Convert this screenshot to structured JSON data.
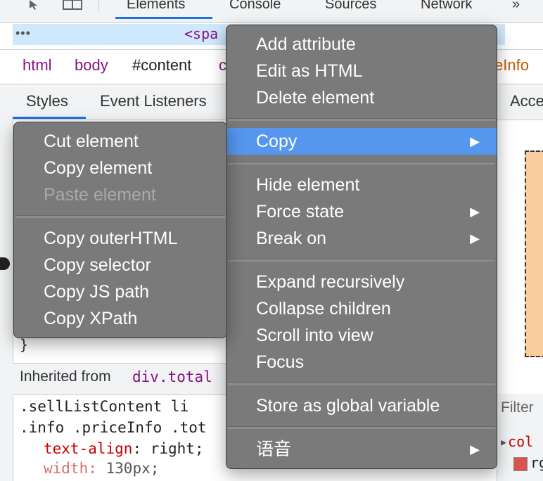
{
  "toolbar": {
    "tabs": [
      "Elements",
      "Console",
      "Sources",
      "Network"
    ],
    "more": "»"
  },
  "dom": {
    "ellipsis": "•••",
    "code": "<spa"
  },
  "breadcrumbs": [
    "html",
    "body",
    "#content",
    "c",
    "eInfo"
  ],
  "subtabs": [
    "Styles",
    "Event Listeners",
    "Acce"
  ],
  "styles_pane": {
    "brace": "}",
    "inherited_label": "Inherited from",
    "inherited_selector": "div.total",
    "rule_line1": ".sellListContent li",
    "rule_line2": ".info .priceInfo .tot",
    "prop1_name": "text-align",
    "prop1_value": "right;",
    "prop2_name": "width",
    "prop2_value": "130px;"
  },
  "right_pane": {
    "filter": "Filter",
    "computed_prop": "col",
    "computed_value": "rg"
  },
  "main_menu": {
    "items": [
      "Add attribute",
      "Edit as HTML",
      "Delete element",
      "Copy",
      "Hide element",
      "Force state",
      "Break on",
      "Expand recursively",
      "Collapse children",
      "Scroll into view",
      "Focus",
      "Store as global variable",
      "语音"
    ],
    "arrow": "▶"
  },
  "copy_submenu": {
    "items": [
      "Cut element",
      "Copy element",
      "Paste element",
      "Copy outerHTML",
      "Copy selector",
      "Copy JS path",
      "Copy XPath"
    ]
  },
  "colors": {
    "highlight": "#5596ee",
    "menu_bg": "#767676",
    "tag_purple": "#881280",
    "accent_blue": "#1a73e8"
  }
}
